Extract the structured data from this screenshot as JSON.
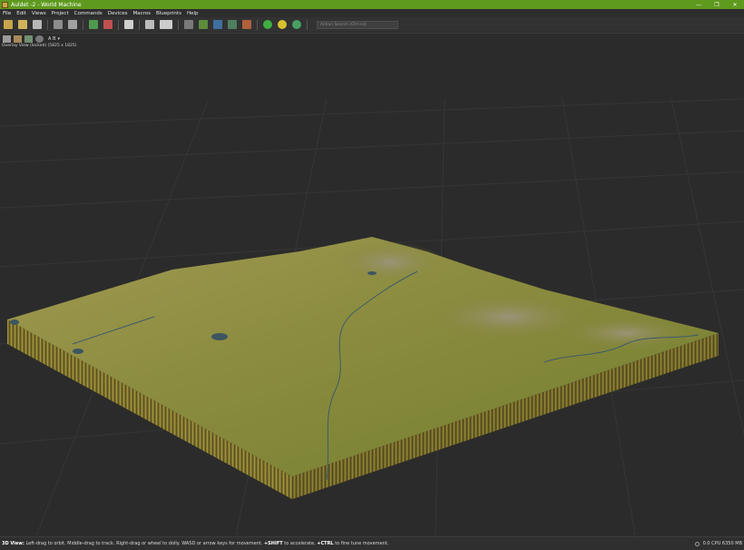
{
  "window": {
    "title": "Auldet -2 - World Machine",
    "controls": [
      "—",
      "❐",
      "✕"
    ]
  },
  "menu": [
    "File",
    "Edit",
    "Views",
    "Project",
    "Commands",
    "Devices",
    "Macros",
    "Blueprints",
    "Help"
  ],
  "toolbar": {
    "search_placeholder": "Action Search (Ctrl+Q)"
  },
  "viewbar": {
    "ab_label": "A B",
    "caption": "Overlay View (locked) (5825 x 1825)"
  },
  "status": {
    "mode_label": "3D View:",
    "text_1": " Left-drag to orbit. Middle-drag to track. Right-drag or wheel to dolly. WASD or arrow keys for movement. ",
    "shift": "+SHIFT",
    "text_2": " to accelerate, ",
    "ctrl": "+CTRL",
    "text_3": " to fine tune movement.",
    "right": "0.0 CPU 6350 MB"
  },
  "colors": {
    "titlebar": "#5e9a1e",
    "viewport_bg": "#2b2b2b",
    "terrain_top": "#8a8a3a",
    "terrain_side": "#7a6f2c"
  }
}
